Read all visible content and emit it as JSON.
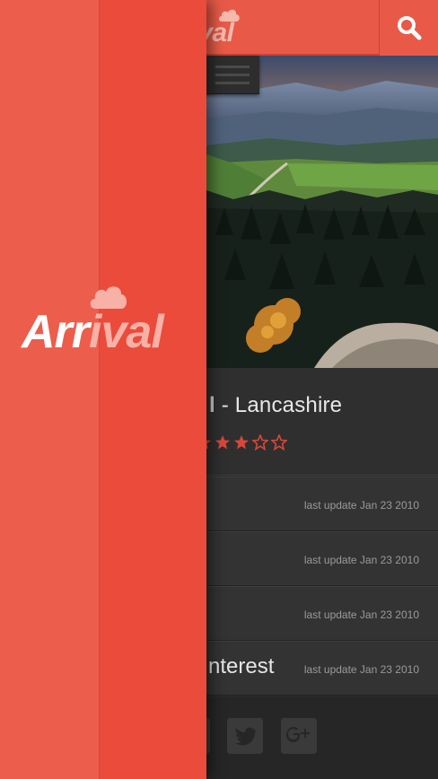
{
  "brand": {
    "name_part1": "Arr",
    "name_part2": "ival",
    "top_visible_part1": "rr",
    "top_visible_part2": "ival"
  },
  "header": {
    "search_icon": "search-icon",
    "menu_icon": "hamburger-icon"
  },
  "place": {
    "title_prefix": "l",
    "title_suffix": " - Lancashire",
    "rating": 3,
    "rating_max": 5
  },
  "list": [
    {
      "label": "",
      "update": "last update Jan 23 2010"
    },
    {
      "label": "",
      "update": "last update Jan 23 2010"
    },
    {
      "label": "",
      "update": "last update Jan 23 2010"
    },
    {
      "label": "nterest",
      "update": "last update Jan 23 2010"
    }
  ],
  "social": [
    "facebook-icon",
    "twitter-icon",
    "google-plus-icon"
  ],
  "colors": {
    "accent": "#e85a47",
    "drawer": "#ec5645",
    "star": "#d9473a",
    "background": "#2b2b2b"
  }
}
